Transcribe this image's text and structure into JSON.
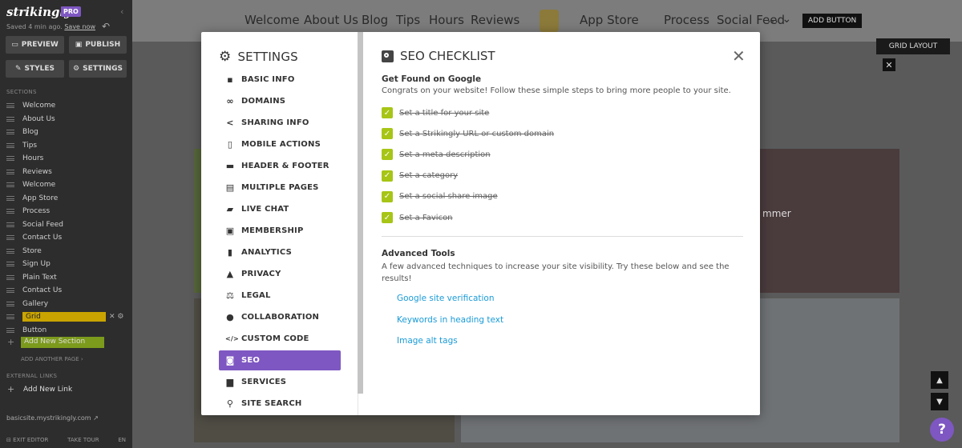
{
  "sidebar": {
    "logo": "strikingly",
    "pro_badge": "PRO",
    "saved_text": "Saved 4 min ago.",
    "save_now": "Save now",
    "preview": "PREVIEW",
    "publish": "PUBLISH",
    "styles": "STYLES",
    "settings": "SETTINGS",
    "sections_heading": "SECTIONS",
    "sections": [
      "Welcome",
      "About Us",
      "Blog",
      "Tips",
      "Hours",
      "Reviews",
      "Welcome",
      "App Store",
      "Process",
      "Social Feed",
      "Contact Us",
      "Store",
      "Sign Up",
      "Plain Text",
      "Contact Us",
      "Gallery",
      "Grid",
      "Button"
    ],
    "active_section": "Grid",
    "add_new_section": "Add New Section",
    "add_another_page": "ADD ANOTHER PAGE",
    "external_links_heading": "EXTERNAL LINKS",
    "add_new_link": "Add New Link",
    "site_url": "basicsite.mystrikingly.com",
    "exit_editor": "EXIT EDITOR",
    "take_tour": "TAKE TOUR",
    "language": "EN"
  },
  "site": {
    "nav_links": [
      "Welcome",
      "About Us",
      "Blog",
      "Tips",
      "Hours",
      "Reviews",
      "App Store",
      "Process",
      "Social Feed"
    ],
    "nav_more": "…",
    "add_button": "ADD BUTTON",
    "grid_layout": "GRID LAYOUT",
    "summer_text": "mmer"
  },
  "modal": {
    "settings_title": "SETTINGS",
    "menu": [
      {
        "label": "BASIC INFO",
        "icon": "briefcase-icon",
        "glyph": "▪"
      },
      {
        "label": "DOMAINS",
        "icon": "link-icon",
        "glyph": "∞"
      },
      {
        "label": "SHARING INFO",
        "icon": "share-icon",
        "glyph": "<"
      },
      {
        "label": "MOBILE ACTIONS",
        "icon": "mobile-icon",
        "glyph": "▯"
      },
      {
        "label": "HEADER & FOOTER",
        "icon": "header-footer-icon",
        "glyph": "▬"
      },
      {
        "label": "MULTIPLE PAGES",
        "icon": "pages-icon",
        "glyph": "▤"
      },
      {
        "label": "LIVE CHAT",
        "icon": "chat-icon",
        "glyph": "▰"
      },
      {
        "label": "MEMBERSHIP",
        "icon": "membership-icon",
        "glyph": "▣"
      },
      {
        "label": "ANALYTICS",
        "icon": "analytics-icon",
        "glyph": "▮"
      },
      {
        "label": "PRIVACY",
        "icon": "lock-icon",
        "glyph": "▲"
      },
      {
        "label": "LEGAL",
        "icon": "legal-icon",
        "glyph": "⚖"
      },
      {
        "label": "COLLABORATION",
        "icon": "users-icon",
        "glyph": "●"
      },
      {
        "label": "CUSTOM CODE",
        "icon": "code-icon",
        "glyph": "</>"
      },
      {
        "label": "SEO",
        "icon": "seo-icon",
        "glyph": "◙"
      },
      {
        "label": "SERVICES",
        "icon": "services-icon",
        "glyph": "▆"
      },
      {
        "label": "SITE SEARCH",
        "icon": "search-icon",
        "glyph": "⚲"
      }
    ],
    "active_menu": "SEO",
    "seo_title": "SEO CHECKLIST",
    "found_title": "Get Found on Google",
    "found_desc": "Congrats on your website! Follow these simple steps to bring more people to your site.",
    "checklist": [
      "Set a title for your site",
      "Set a Strikingly URL or custom domain",
      "Set a meta description",
      "Set a category",
      "Set a social share image",
      "Set a Favicon"
    ],
    "advanced_title": "Advanced Tools",
    "advanced_desc": "A few advanced techniques to increase your site visibility. Try these below and see the results!",
    "advanced_links": [
      "Google site verification",
      "Keywords in heading text",
      "Image alt tags"
    ]
  },
  "colors": {
    "accent": "#7e57c2",
    "check_green": "#a6c516",
    "link_blue": "#1a9bd7"
  }
}
